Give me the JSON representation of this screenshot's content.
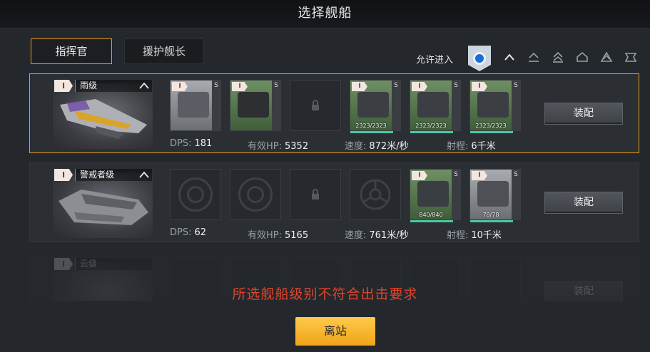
{
  "title": "选择舰船",
  "tabs": [
    "指挥官",
    "援护舰长"
  ],
  "allow_label": "允许进入",
  "tier_icons": [
    "tier-1-icon",
    "tier-2-icon",
    "tier-3-icon",
    "tier-4-icon",
    "tier-5-icon",
    "tier-6-icon"
  ],
  "ships": [
    {
      "badge": "I",
      "name": "雨级",
      "slots": [
        {
          "type": "grey-module",
          "side": "S"
        },
        {
          "type": "green-module",
          "side": "S"
        },
        {
          "type": "locked"
        },
        {
          "type": "green-module",
          "side": "S",
          "hp": "2323/2323",
          "hp_fraction": 1.0
        },
        {
          "type": "green-module",
          "side": "S",
          "hp": "2323/2323",
          "hp_fraction": 1.0
        },
        {
          "type": "green-module",
          "side": "S",
          "hp": "2323/2323",
          "hp_fraction": 1.0
        }
      ],
      "dps_label": "DPS:",
      "dps": "181",
      "hp_label": "有效HP:",
      "hp": "5352",
      "speed_label": "速度:",
      "speed": "872米/秒",
      "range_label": "射程:",
      "range": "6千米",
      "equip": "装配"
    },
    {
      "badge": "I",
      "name": "警戒者级",
      "slots": [
        {
          "type": "empty"
        },
        {
          "type": "empty"
        },
        {
          "type": "locked"
        },
        {
          "type": "empty-special"
        },
        {
          "type": "green-module",
          "side": "S",
          "hp": "840/840",
          "hp_fraction": 1.0
        },
        {
          "type": "grey-module",
          "side": "S",
          "hp": "78/78",
          "hp_fraction": 1.0
        }
      ],
      "dps_label": "DPS:",
      "dps": "62",
      "hp_label": "有效HP:",
      "hp": "5165",
      "speed_label": "速度:",
      "speed": "761米/秒",
      "range_label": "射程:",
      "range": "10千米",
      "equip": "装配"
    },
    {
      "badge": "I",
      "name": "云级",
      "equip": "装配"
    }
  ],
  "warning": "所选舰船级别不符合出击要求",
  "depart": "离站"
}
